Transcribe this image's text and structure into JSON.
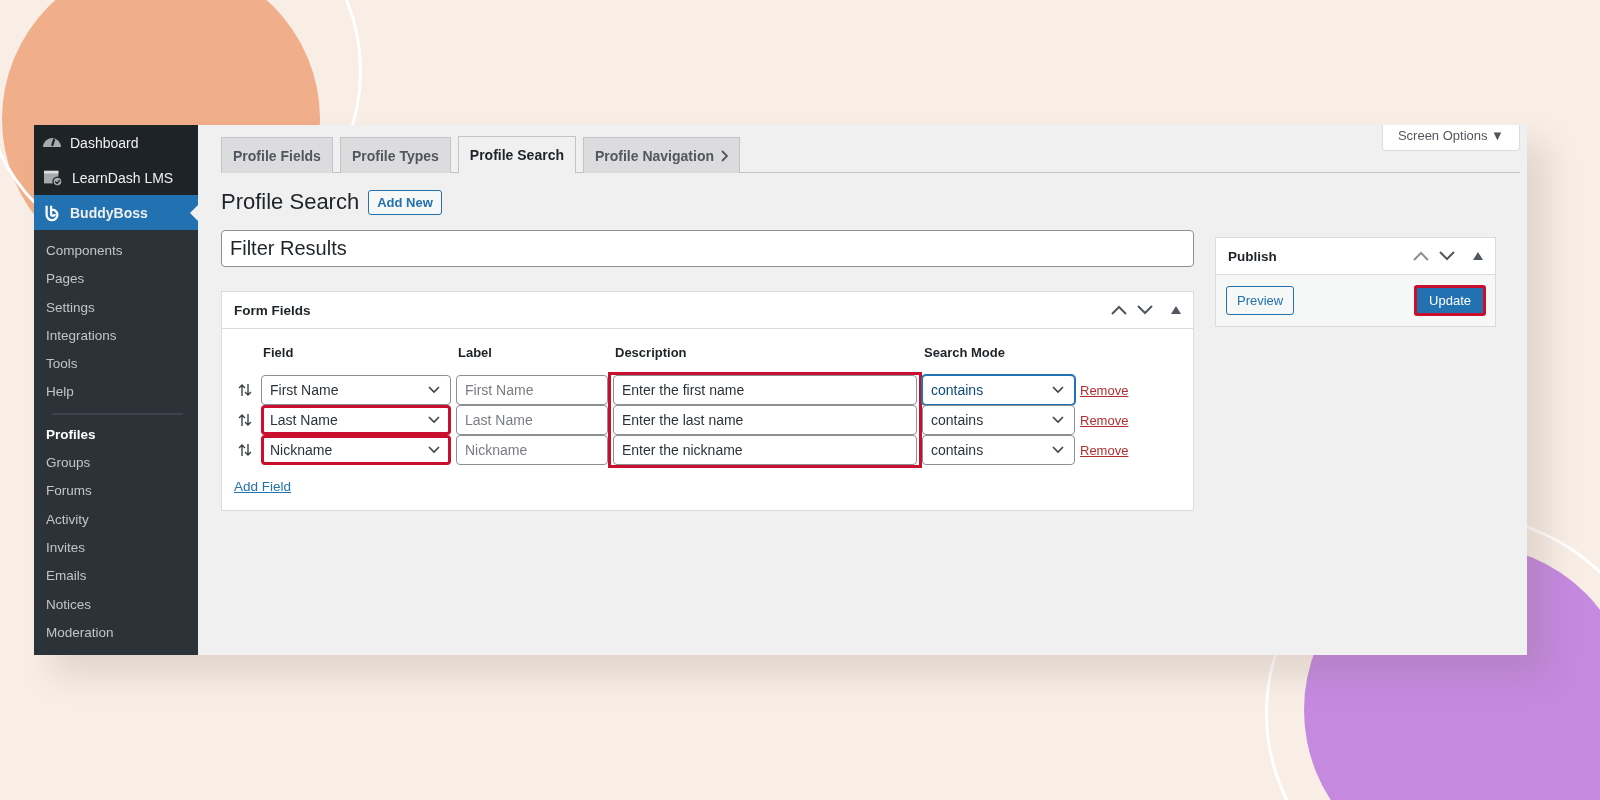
{
  "sidebar": {
    "items": [
      {
        "label": "Dashboard",
        "kind": "top",
        "selected": false
      },
      {
        "label": "LearnDash LMS",
        "kind": "top",
        "selected": false
      },
      {
        "label": "BuddyBoss",
        "kind": "top",
        "selected": true
      },
      {
        "label": "Components",
        "kind": "sub",
        "selected": false
      },
      {
        "label": "Pages",
        "kind": "sub",
        "selected": false
      },
      {
        "label": "Settings",
        "kind": "sub",
        "selected": false
      },
      {
        "label": "Integrations",
        "kind": "sub",
        "selected": false
      },
      {
        "label": "Tools",
        "kind": "sub",
        "selected": false
      },
      {
        "label": "Help",
        "kind": "sub",
        "selected": false
      },
      {
        "label": "Profiles",
        "kind": "sub",
        "selected": true,
        "divider_before": true
      },
      {
        "label": "Groups",
        "kind": "sub",
        "selected": false
      },
      {
        "label": "Forums",
        "kind": "sub",
        "selected": false
      },
      {
        "label": "Activity",
        "kind": "sub",
        "selected": false
      },
      {
        "label": "Invites",
        "kind": "sub",
        "selected": false
      },
      {
        "label": "Emails",
        "kind": "sub",
        "selected": false
      },
      {
        "label": "Notices",
        "kind": "sub",
        "selected": false
      },
      {
        "label": "Moderation",
        "kind": "sub",
        "selected": false
      }
    ]
  },
  "screen_options": "Screen Options ▼",
  "tabs": [
    {
      "label": "Profile Fields",
      "selected": false
    },
    {
      "label": "Profile Types",
      "selected": false
    },
    {
      "label": "Profile Search",
      "selected": true
    },
    {
      "label": "Profile Navigation",
      "selected": false,
      "more": true
    }
  ],
  "page_title": "Profile Search",
  "add_new": "Add New",
  "title_field": "Filter Results",
  "form_fields": {
    "title": "Form Fields",
    "columns": [
      "Field",
      "Label",
      "Description",
      "Search Mode"
    ],
    "description_highlighted": true,
    "rows": [
      {
        "field": "First Name",
        "label_placeholder": "First Name",
        "description": "Enter the first name",
        "mode": "contains",
        "field_highlighted": false,
        "mode_focused": true,
        "remove": "Remove"
      },
      {
        "field": "Last Name",
        "label_placeholder": "Last Name",
        "description": "Enter the last name",
        "mode": "contains",
        "field_highlighted": true,
        "mode_focused": false,
        "remove": "Remove"
      },
      {
        "field": "Nickname",
        "label_placeholder": "Nickname",
        "description": "Enter the nickname",
        "mode": "contains",
        "field_highlighted": true,
        "mode_focused": false,
        "remove": "Remove"
      }
    ],
    "add_field": "Add Field"
  },
  "publish": {
    "title": "Publish",
    "preview": "Preview",
    "update": "Update",
    "update_highlighted": true
  }
}
